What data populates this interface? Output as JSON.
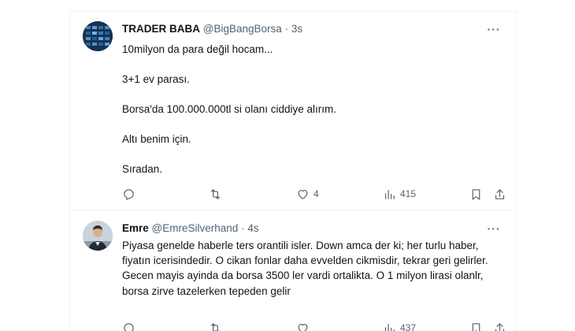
{
  "tweets": [
    {
      "author_name": "TRADER BABA",
      "handle": "@BigBangBorsa",
      "separator": "·",
      "time": "3s",
      "paragraphs": [
        "10milyon da para değil hocam...",
        "3+1 ev parası.",
        "Borsa'da 100.000.000tl si olanı ciddiye alırım.",
        "Altı benim için.",
        "Sıradan."
      ],
      "actions": {
        "replies": "",
        "retweets": "",
        "likes": "4",
        "views": "415"
      }
    },
    {
      "author_name": "Emre",
      "handle": "@EmreSilverhand",
      "separator": "·",
      "time": "4s",
      "text": "Piyasa genelde haberle ters orantili isler. Down amca der ki; her turlu haber, fiyatın icerisindedir. O cikan fonlar daha evvelden cikmisdir, tekrar geri gelirler. Gecen mayis ayinda da borsa 3500 ler vardi ortalikta. O 1 milyon lirasi olanlr, borsa zirve tazelerken tepeden gelir",
      "actions": {
        "replies": "",
        "retweets": "",
        "likes": "",
        "views": "437"
      }
    }
  ],
  "icons": {
    "more": "more-icon",
    "reply": "reply-icon",
    "retweet": "retweet-icon",
    "like": "heart-icon",
    "views": "views-icon",
    "bookmark": "bookmark-icon",
    "share": "share-icon"
  },
  "colors": {
    "text": "#0f1419",
    "secondary": "#536471",
    "border": "#eff3f4"
  }
}
